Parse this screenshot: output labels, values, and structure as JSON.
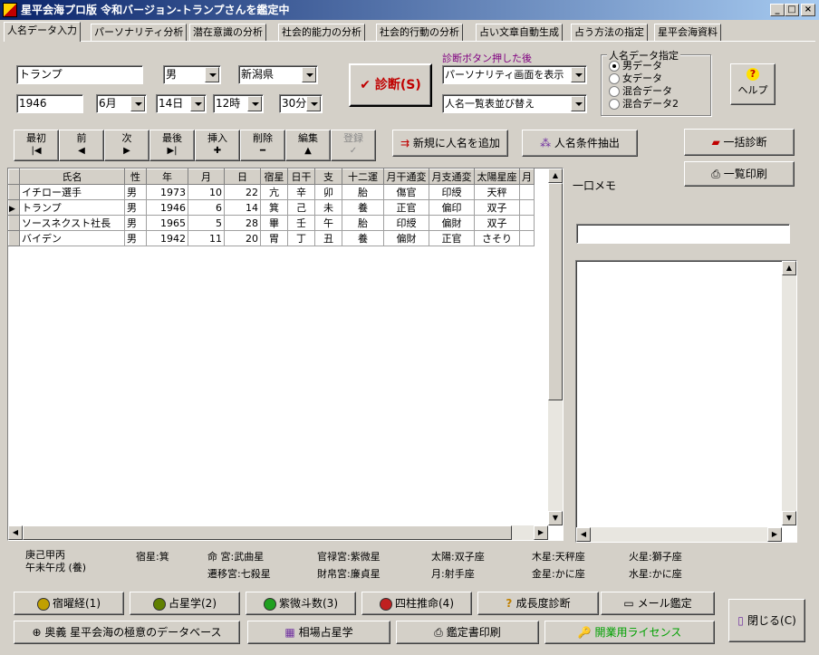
{
  "window": {
    "title": "星平会海プロ版 令和バージョン-トランプさんを鑑定中",
    "min": "_",
    "max": "□",
    "close": "×"
  },
  "tabs": [
    "人名データ入力",
    "パーソナリティ分析",
    "潜在意識の分析",
    "社会的能力の分析",
    "社会的行動の分析",
    "占い文章自動生成",
    "占う方法の指定",
    "星平会海資料"
  ],
  "form": {
    "name": "トランプ",
    "gender": "男",
    "prefecture": "新潟県",
    "year": "1946",
    "month": "6月",
    "day": "14日",
    "hour": "12時",
    "minute": "30分",
    "diagnose_button": "診断(S)",
    "after_label": "診断ボタン押した後",
    "after_select1": "パーソナリティ画面を表示",
    "after_select2": "人名一覧表並び替え",
    "data_group_title": "人名データ指定",
    "data_options": [
      "男データ",
      "女データ",
      "混合データ",
      "混合データ2"
    ],
    "data_selected": 0,
    "help_label": "ヘルプ"
  },
  "nav": [
    {
      "label": "最初",
      "glyph": "|◀"
    },
    {
      "label": "前",
      "glyph": "◀"
    },
    {
      "label": "次",
      "glyph": "▶"
    },
    {
      "label": "最後",
      "glyph": "▶|"
    },
    {
      "label": "挿入",
      "glyph": "✚"
    },
    {
      "label": "削除",
      "glyph": "━"
    },
    {
      "label": "編集",
      "glyph": "▲"
    },
    {
      "label": "登録",
      "glyph": "✓"
    }
  ],
  "actions": {
    "add_new": "新規に人名を追加",
    "extract": "人名条件抽出",
    "bulk_diagnose": "一括診断",
    "print_list": "一覧印刷",
    "memo_label": "一口メモ"
  },
  "table": {
    "columns": [
      "氏名",
      "性",
      "年",
      "月",
      "日",
      "宿星",
      "日干",
      "支",
      "十二運",
      "月干通変",
      "月支通変",
      "太陽星座",
      "月"
    ],
    "rows": [
      [
        "イチロー選手",
        "男",
        "1973",
        "10",
        "22",
        "亢",
        "辛",
        "卯",
        "胎",
        "傷官",
        "印綬",
        "天秤",
        ""
      ],
      [
        "トランプ",
        "男",
        "1946",
        "6",
        "14",
        "箕",
        "己",
        "未",
        "養",
        "正官",
        "偏印",
        "双子",
        ""
      ],
      [
        "ソースネクスト社長",
        "男",
        "1965",
        "5",
        "28",
        "畢",
        "壬",
        "午",
        "胎",
        "印綬",
        "偏財",
        "双子",
        ""
      ],
      [
        "バイデン",
        "男",
        "1942",
        "11",
        "20",
        "胃",
        "丁",
        "丑",
        "養",
        "偏財",
        "正官",
        "さそり",
        ""
      ]
    ],
    "current_row": 1
  },
  "info": {
    "ganzhi1": "庚己甲丙",
    "ganzhi2": "午未午戌 (養)",
    "shukusei": "宿星:箕",
    "mei": "命 宮:武曲星",
    "senni": "遷移宮:七殺星",
    "kanroku": "官禄宮:紫微星",
    "zaihaku": "財帛宮:廉貞星",
    "sun": "太陽:双子座",
    "moon": "月:射手座",
    "jupiter": "木星:天秤座",
    "venus": "金星:かに座",
    "mars": "火星:獅子座",
    "mercury": "水星:かに座"
  },
  "bottom": {
    "row1": [
      "宿曜経(1)",
      "占星学(2)",
      "紫微斗数(3)",
      "四柱推命(4)",
      "成長度診断",
      "メール鑑定"
    ],
    "row2": [
      "奥義 星平会海の極意のデータベース",
      "相場占星学",
      "鑑定書印刷",
      "開業用ライセンス"
    ],
    "close": "閉じる(C)"
  }
}
